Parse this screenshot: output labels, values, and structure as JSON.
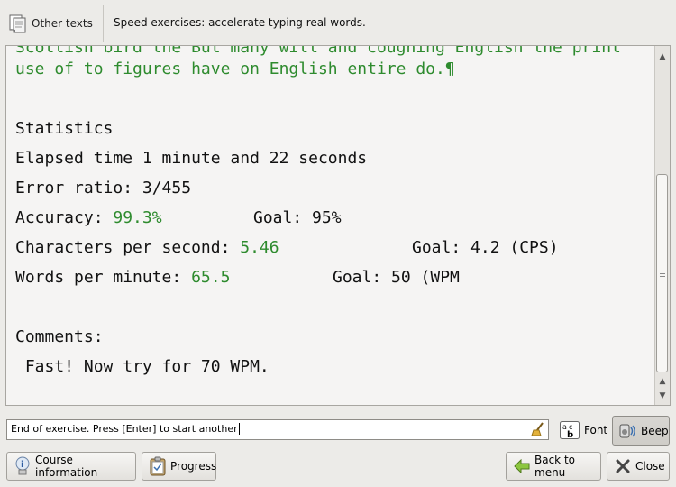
{
  "toolbar": {
    "other_texts_label": "Other texts",
    "title": "Speed exercises: accelerate typing real words."
  },
  "exercise_text": {
    "line_partial": "Scottish bird the But many will and coughing English the print",
    "line_end": "use of to figures have on English entire do.¶"
  },
  "statistics": {
    "heading": "Statistics",
    "elapsed": "Elapsed time 1 minute and 22 seconds",
    "error_ratio": "Error ratio: 3/455",
    "accuracy_label": "Accuracy: ",
    "accuracy_value": "99.3%",
    "accuracy_goal": "Goal: 95%",
    "cps_label": "Characters per second: ",
    "cps_value": "5.46",
    "cps_goal": "Goal: 4.2 (CPS)",
    "wpm_label": "Words per minute: ",
    "wpm_value": "65.5",
    "wpm_goal": "Goal: 50 (WPM",
    "comments_heading": "Comments:",
    "comments_text": " Fast! Now try for 70 WPM."
  },
  "input": {
    "value": "End of exercise. Press [Enter] to start another"
  },
  "buttons": {
    "font_label": "Font",
    "beep_label": "Beep",
    "course_info_label": "Course information",
    "progress_label": "Progress",
    "back_to_menu_label": "Back to menu",
    "close_label": "Close"
  },
  "colors": {
    "correct_text": "#2e8b2e",
    "background": "#ecebe8",
    "pane": "#f5f4f3"
  },
  "icons": [
    "documents-icon",
    "broom-icon",
    "font-icon",
    "speaker-icon",
    "info-bulb-icon",
    "clipboard-icon",
    "back-arrow-icon",
    "close-x-icon"
  ],
  "scroll_position": 0.6
}
